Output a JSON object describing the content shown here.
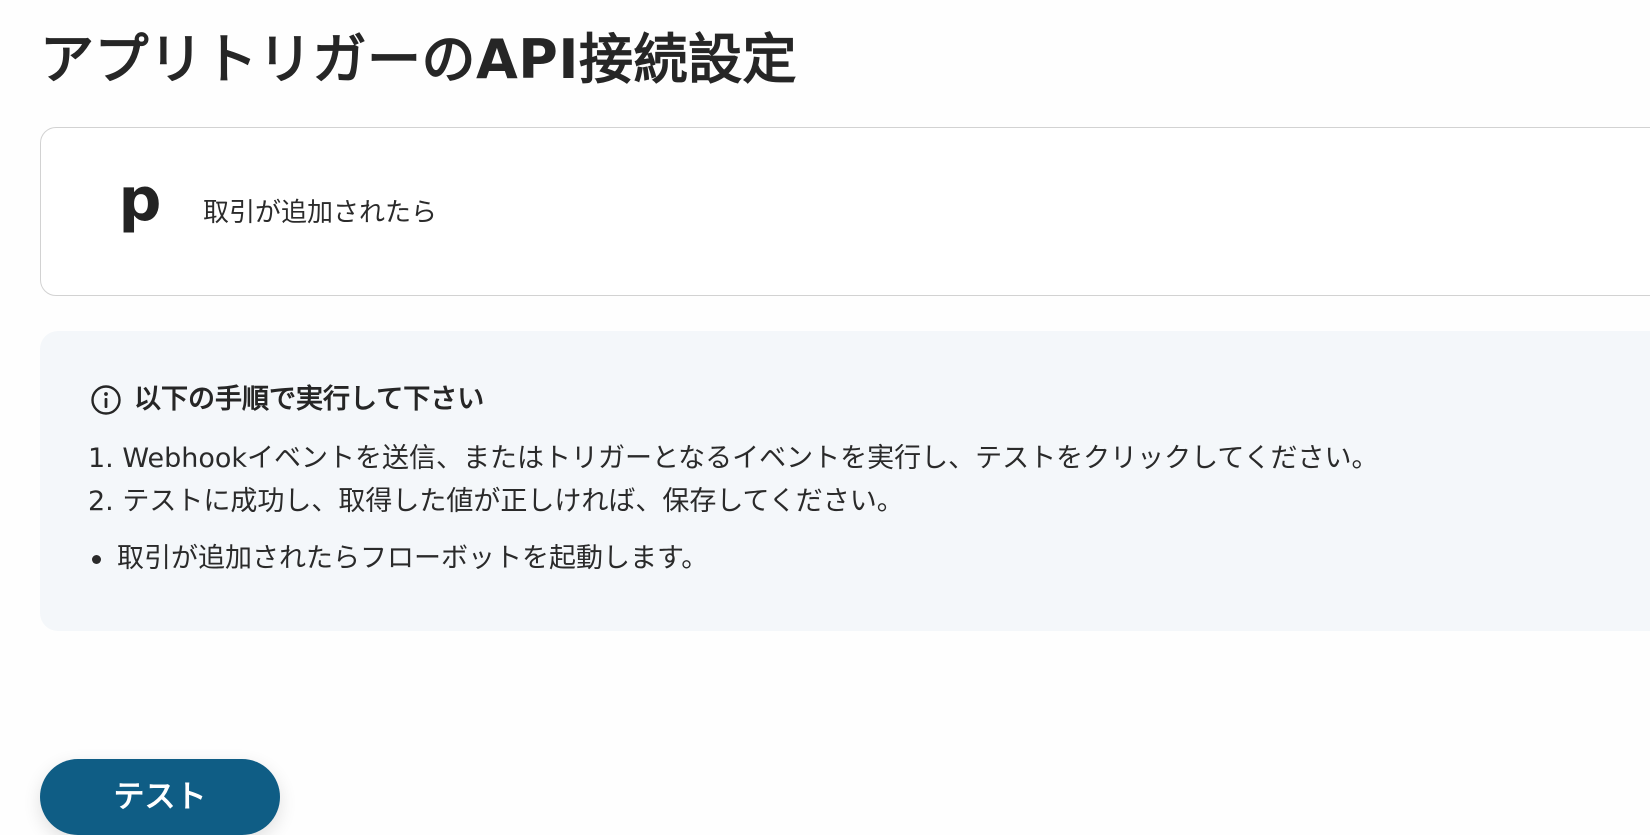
{
  "page": {
    "title": "アプリトリガーのAPI接続設定"
  },
  "trigger": {
    "logo_letter": "p",
    "label": "取引が追加されたら"
  },
  "info": {
    "icon": "info-circle-icon",
    "title": "以下の手順で実行して下さい",
    "steps": [
      "1. Webhookイベントを送信、またはトリガーとなるイベントを実行し、テストをクリックしてください。",
      "2. テストに成功し、取得した値が正しければ、保存してください。"
    ],
    "note": "取引が追加されたらフローボットを起動します。"
  },
  "actions": {
    "test_label": "テスト"
  },
  "colors": {
    "button_bg": "#0f5d85",
    "info_bg": "#f4f7fa",
    "card_border": "#d2d2d2"
  }
}
